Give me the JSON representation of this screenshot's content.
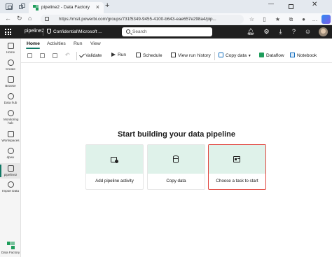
{
  "browser": {
    "tab_title": "pipeline2 - Data Factory",
    "url": "https://msit.powerbi.com/groups/731f5349-9455-4100-b643-eae657e298a4/pip..."
  },
  "appbar": {
    "item_name": "pipeline2",
    "sensitivity": "Confidential\\Microsoft ...",
    "search_placeholder": "Search"
  },
  "leftnav": {
    "items": [
      {
        "label": "Home",
        "icon": "home-icon"
      },
      {
        "label": "Create",
        "icon": "create-icon"
      },
      {
        "label": "Browse",
        "icon": "browse-icon"
      },
      {
        "label": "Data hub",
        "icon": "data-hub-icon"
      },
      {
        "label": "Monitoring hub",
        "icon": "monitoring-icon"
      },
      {
        "label": "Workspaces",
        "icon": "workspaces-icon"
      },
      {
        "label": "dpwx",
        "icon": "workspace-icon"
      },
      {
        "label": "pipeline2",
        "icon": "pipeline-icon"
      },
      {
        "label": "Import Data",
        "icon": "import-data-icon"
      }
    ],
    "app_name": "Data Factory"
  },
  "ribbon": {
    "tabs": [
      "Home",
      "Activities",
      "Run",
      "View"
    ],
    "active_tab": "Home",
    "tools": {
      "validate": "Validate",
      "run": "Run",
      "schedule": "Schedule",
      "view_run_history": "View run history",
      "copy_data": "Copy data",
      "dataflow": "Dataflow",
      "notebook": "Notebook"
    }
  },
  "canvas": {
    "title": "Start building your data pipeline",
    "cards": [
      {
        "label": "Add pipeline activity",
        "icon": "add-activity-icon"
      },
      {
        "label": "Copy data",
        "icon": "copy-data-icon"
      },
      {
        "label": "Choose a task to start",
        "icon": "task-template-icon"
      }
    ]
  },
  "colors": {
    "accent": "#117865",
    "card_top": "#dff2ea",
    "highlight": "#e0443c",
    "appbar": "#1f1f1f"
  }
}
